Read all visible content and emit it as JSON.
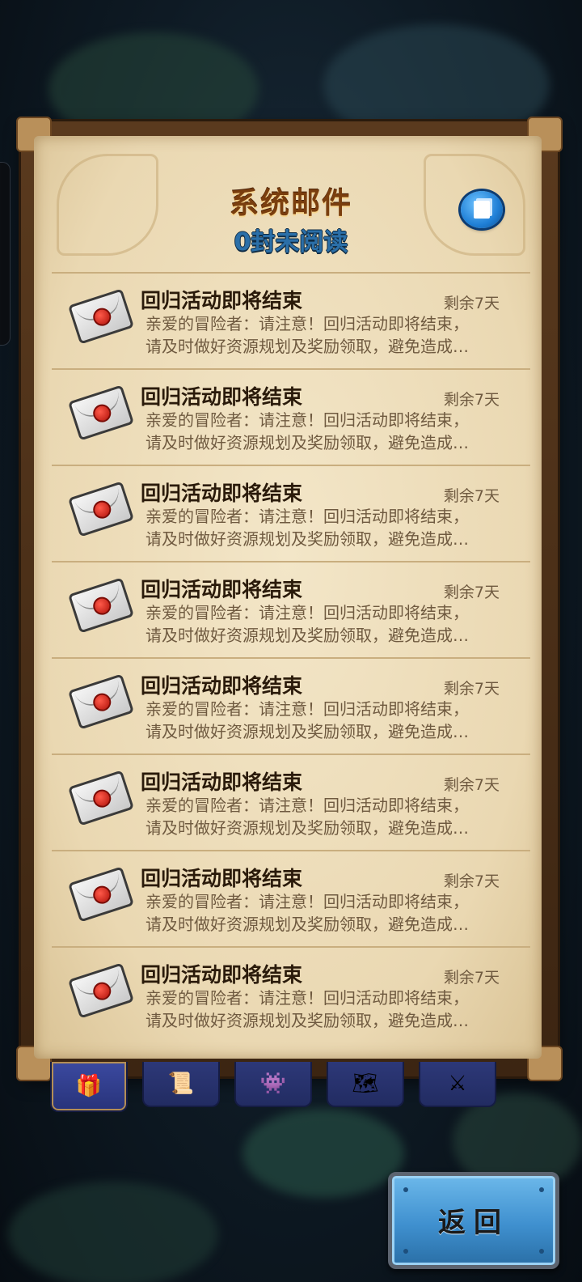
{
  "header": {
    "title": "系统邮件",
    "unread": "0封未阅读"
  },
  "mails": [
    {
      "title": "回归活动即将结束",
      "days_left": "剩余7天",
      "preview_line1": "亲爱的冒险者：请注意！回归活动即将结束，",
      "preview_line2": "请及时做好资源规划及奖励领取，避免造成…"
    },
    {
      "title": "回归活动即将结束",
      "days_left": "剩余7天",
      "preview_line1": "亲爱的冒险者：请注意！回归活动即将结束，",
      "preview_line2": "请及时做好资源规划及奖励领取，避免造成…"
    },
    {
      "title": "回归活动即将结束",
      "days_left": "剩余7天",
      "preview_line1": "亲爱的冒险者：请注意！回归活动即将结束，",
      "preview_line2": "请及时做好资源规划及奖励领取，避免造成…"
    },
    {
      "title": "回归活动即将结束",
      "days_left": "剩余7天",
      "preview_line1": "亲爱的冒险者：请注意！回归活动即将结束，",
      "preview_line2": "请及时做好资源规划及奖励领取，避免造成…"
    },
    {
      "title": "回归活动即将结束",
      "days_left": "剩余7天",
      "preview_line1": "亲爱的冒险者：请注意！回归活动即将结束，",
      "preview_line2": "请及时做好资源规划及奖励领取，避免造成…"
    },
    {
      "title": "回归活动即将结束",
      "days_left": "剩余7天",
      "preview_line1": "亲爱的冒险者：请注意！回归活动即将结束，",
      "preview_line2": "请及时做好资源规划及奖励领取，避免造成…"
    },
    {
      "title": "回归活动即将结束",
      "days_left": "剩余7天",
      "preview_line1": "亲爱的冒险者：请注意！回归活动即将结束，",
      "preview_line2": "请及时做好资源规划及奖励领取，避免造成…"
    },
    {
      "title": "回归活动即将结束",
      "days_left": "剩余7天",
      "preview_line1": "亲爱的冒险者：请注意！回归活动即将结束，",
      "preview_line2": "请及时做好资源规划及奖励领取，避免造成…"
    }
  ],
  "tabs": [
    {
      "icon": "gift-box-icon",
      "glyph": "🎁",
      "active": true
    },
    {
      "icon": "scroll-banner-icon",
      "glyph": "📜",
      "active": false
    },
    {
      "icon": "monsters-icon",
      "glyph": "👾",
      "active": false
    },
    {
      "icon": "map-scroll-icon",
      "glyph": "🗺",
      "active": false
    },
    {
      "icon": "crossed-swords-icon",
      "glyph": "⚔",
      "active": false
    }
  ],
  "footer": {
    "back_label": "返回"
  },
  "colors": {
    "title": "#7a3e0e",
    "unread": "#2b6fa8",
    "parchment": "#ead8b2",
    "tab": "#2d3878",
    "back_button": "#3f90cf"
  }
}
